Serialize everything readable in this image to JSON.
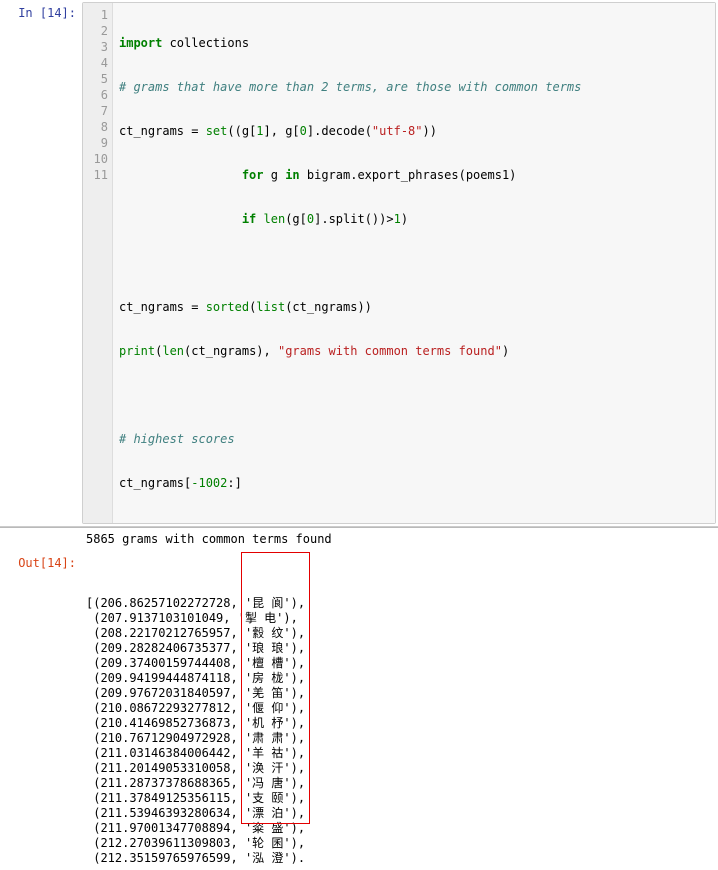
{
  "cell": {
    "in_prompt": "In [14]:",
    "out_prompt": "Out[14]:",
    "gutter": [
      "1",
      "2",
      "3",
      "4",
      "5",
      "6",
      "7",
      "8",
      "9",
      "10",
      "11"
    ],
    "code": {
      "l1_a": "import",
      "l1_b": " collections",
      "l2": "# grams that have more than 2 terms, are those with common terms",
      "l3_a": "ct_ngrams = ",
      "l3_b": "set",
      "l3_c": "((g[",
      "l3_d": "1",
      "l3_e": "], g[",
      "l3_f": "0",
      "l3_g": "].decode(",
      "l3_h": "\"utf-8\"",
      "l3_i": "))",
      "l4_a": "                 ",
      "l4_b": "for",
      "l4_c": " g ",
      "l4_d": "in",
      "l4_e": " bigram.export_phrases(poems1)",
      "l5_a": "                 ",
      "l5_b": "if",
      "l5_c": " ",
      "l5_d": "len",
      "l5_e": "(g[",
      "l5_f": "0",
      "l5_g": "].split())>",
      "l5_h": "1",
      "l5_i": ")",
      "l6": "",
      "l7_a": "ct_ngrams = ",
      "l7_b": "sorted",
      "l7_c": "(",
      "l7_d": "list",
      "l7_e": "(ct_ngrams))",
      "l8_a": "print",
      "l8_b": "(",
      "l8_c": "len",
      "l8_d": "(ct_ngrams), ",
      "l8_e": "\"grams with common terms found\"",
      "l8_f": ")",
      "l9": "",
      "l10": "# highest scores",
      "l11_a": "ct_ngrams[",
      "l11_b": "-1002",
      "l11_c": ":]"
    },
    "stdout": "5865 grams with common terms found",
    "result": [
      {
        "pre": "[",
        "score": "206.86257102272728",
        "term": "'昆 阆')"
      },
      {
        "pre": " ",
        "score": "207.9137103101049",
        "term": "'掣 电')"
      },
      {
        "pre": " ",
        "score": "208.22170212765957",
        "term": "'縠 纹')"
      },
      {
        "pre": " ",
        "score": "209.28282406735377",
        "term": "'琅 琅')"
      },
      {
        "pre": " ",
        "score": "209.37400159744408",
        "term": "'檀 槽')"
      },
      {
        "pre": " ",
        "score": "209.94199444874118",
        "term": "'房 栊')"
      },
      {
        "pre": " ",
        "score": "209.97672031840597",
        "term": "'羌 笛')"
      },
      {
        "pre": " ",
        "score": "210.08672293277812",
        "term": "'偃 仰')"
      },
      {
        "pre": " ",
        "score": "210.41469852736873",
        "term": "'机 杼')"
      },
      {
        "pre": " ",
        "score": "210.76712904972928",
        "term": "'肃 肃')"
      },
      {
        "pre": " ",
        "score": "211.03146384006442",
        "term": "'羊 祜')"
      },
      {
        "pre": " ",
        "score": "211.20149053310058",
        "term": "'涣 汗')"
      },
      {
        "pre": " ",
        "score": "211.28737378688365",
        "term": "'冯 唐')"
      },
      {
        "pre": " ",
        "score": "211.37849125356115",
        "term": "'支 颐')"
      },
      {
        "pre": " ",
        "score": "211.53946393280634",
        "term": "'漂 泊')"
      },
      {
        "pre": " ",
        "score": "211.97001347708894",
        "term": "'粢 盛')"
      },
      {
        "pre": " ",
        "score": "212.27039611309803",
        "term": "'轮 囷')"
      },
      {
        "pre": " ",
        "score": "212.35159765976599",
        "term": "'泓 澄')"
      }
    ]
  }
}
